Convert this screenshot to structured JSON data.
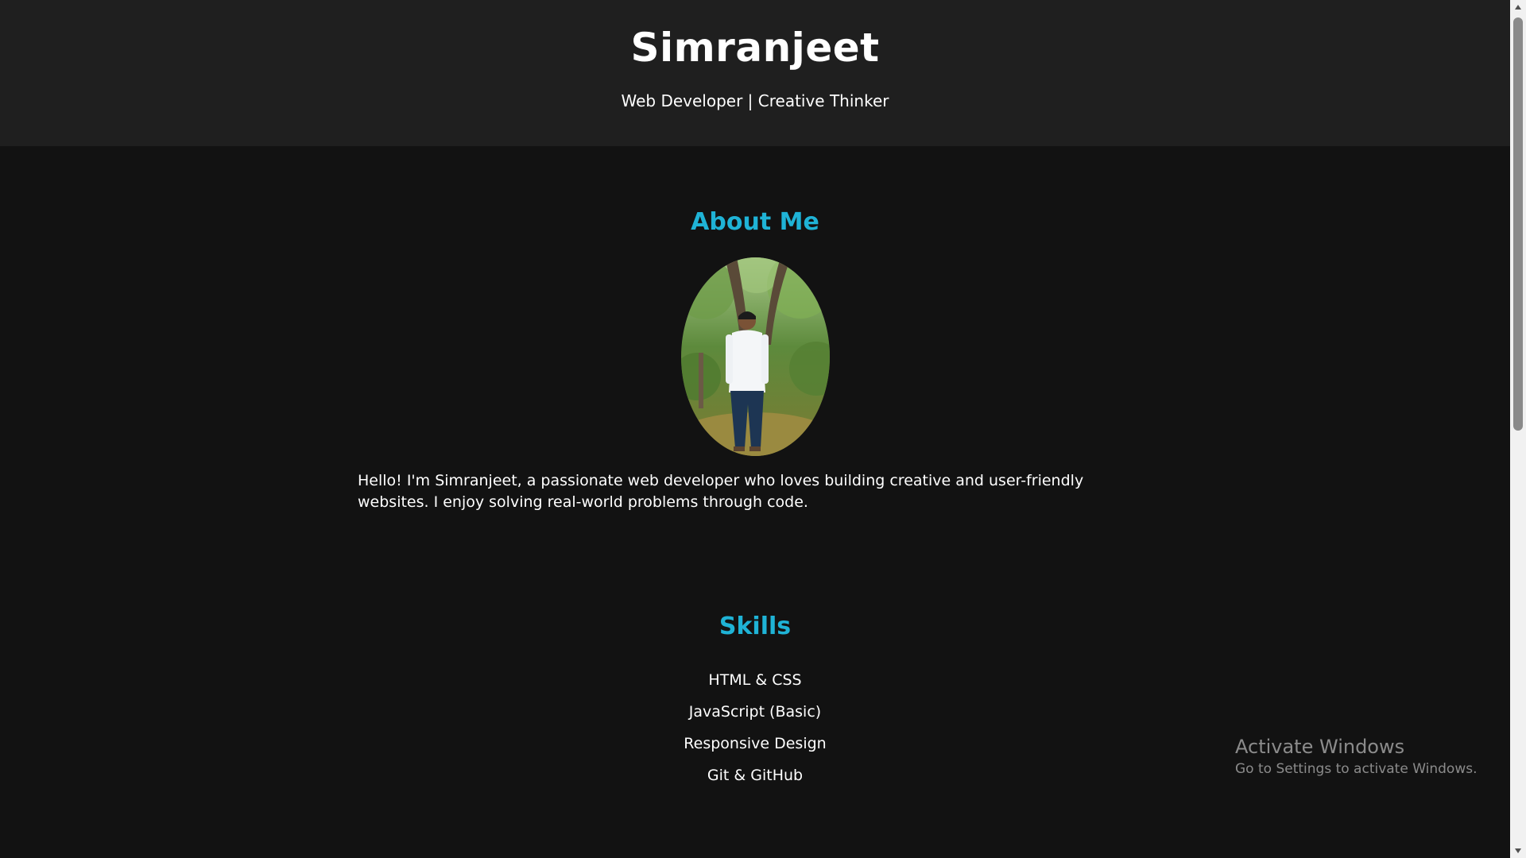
{
  "header": {
    "name": "Simranjeet",
    "tagline": "Web Developer | Creative Thinker"
  },
  "about": {
    "heading": "About Me",
    "photo_icon": "profile-photo",
    "text": "Hello! I'm Simranjeet, a passionate web developer who loves building creative and user-friendly websites. I enjoy solving real-world problems through code."
  },
  "skills": {
    "heading": "Skills",
    "items": [
      "HTML & CSS",
      "JavaScript (Basic)",
      "Responsive Design",
      "Git & GitHub"
    ]
  },
  "watermark": {
    "title": "Activate Windows",
    "subtitle": "Go to Settings to activate Windows."
  },
  "colors": {
    "background": "#121212",
    "header_background": "#1f1f1f",
    "accent": "#1fb3d6",
    "text": "#ffffff"
  }
}
